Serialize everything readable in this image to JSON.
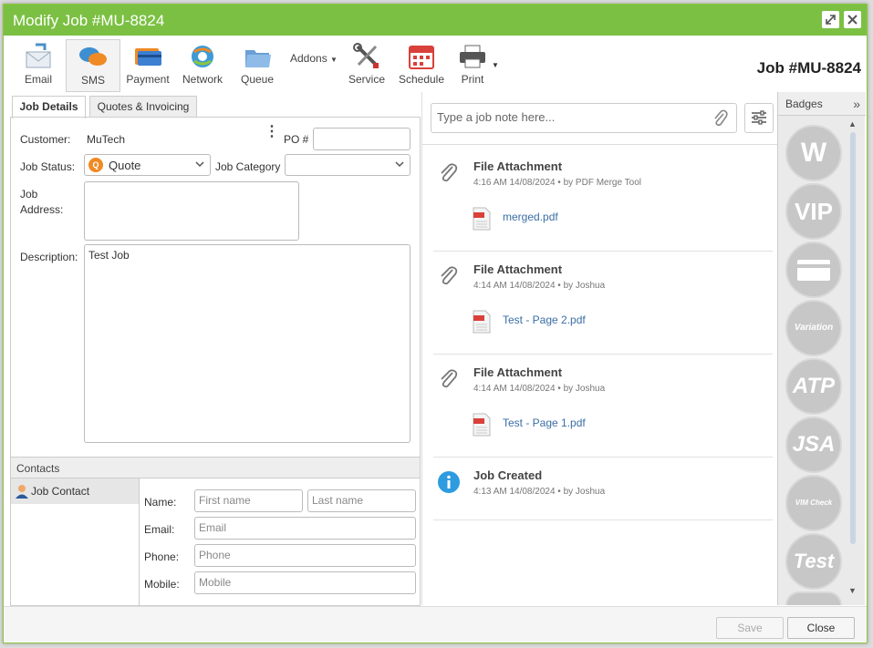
{
  "window": {
    "title": "Modify Job #MU-8824",
    "job_number": "Job #MU-8824",
    "accent": "#7bc043"
  },
  "toolbar": {
    "email": "Email",
    "sms": "SMS",
    "payment": "Payment",
    "network": "Network",
    "queue": "Queue",
    "addons": "Addons",
    "service": "Service",
    "schedule": "Schedule",
    "print": "Print"
  },
  "tabs": {
    "job_details": "Job Details",
    "quotes": "Quotes & Invoicing"
  },
  "form": {
    "customer_label": "Customer:",
    "customer_value": "MuTech",
    "po_label": "PO #",
    "po_value": "",
    "status_label": "Job Status:",
    "status_value": "Quote",
    "status_badge": "Q",
    "category_label": "Job Category",
    "category_value": "",
    "address_label_1": "Job",
    "address_label_2": "Address:",
    "address_value": "",
    "description_label": "Description:",
    "description_value": "Test Job"
  },
  "contacts": {
    "header": "Contacts",
    "item": "Job Contact",
    "name_label": "Name:",
    "first_placeholder": "First name",
    "last_placeholder": "Last name",
    "email_label": "Email:",
    "email_placeholder": "Email",
    "phone_label": "Phone:",
    "phone_placeholder": "Phone",
    "mobile_label": "Mobile:",
    "mobile_placeholder": "Mobile"
  },
  "notes": {
    "placeholder": "Type a job note here...",
    "entries": [
      {
        "title": "File Attachment",
        "time": "4:16 AM 14/08/2024",
        "by": "by PDF Merge Tool",
        "file": "merged.pdf",
        "icon": "paperclip-icon"
      },
      {
        "title": "File Attachment",
        "time": "4:14 AM 14/08/2024",
        "by": "by Joshua",
        "file": "Test - Page 2.pdf",
        "icon": "paperclip-icon"
      },
      {
        "title": "File Attachment",
        "time": "4:14 AM 14/08/2024",
        "by": "by Joshua",
        "file": "Test - Page 1.pdf",
        "icon": "paperclip-icon"
      },
      {
        "title": "Job Created",
        "time": "4:13 AM 14/08/2024",
        "by": "by Joshua",
        "icon": "info-icon"
      }
    ]
  },
  "badges": {
    "header": "Badges",
    "items": [
      "W",
      "VIP",
      "",
      "Variation",
      "ATP",
      "JSA",
      "VIM Check",
      "Test"
    ]
  },
  "footer": {
    "save": "Save",
    "close": "Close"
  }
}
